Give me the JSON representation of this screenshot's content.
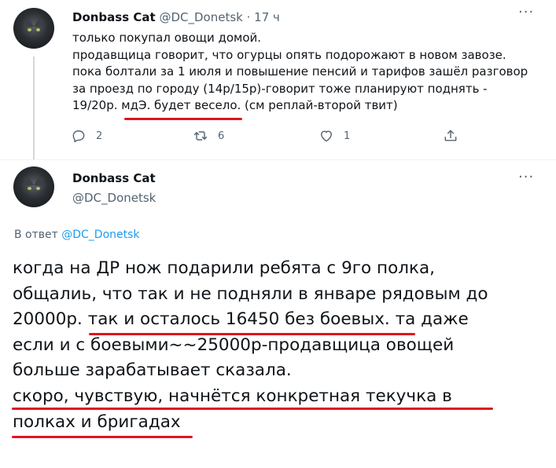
{
  "tweet": {
    "author_name": "Donbass Cat",
    "handle": "@DC_Donetsk",
    "time": "· 17 ч",
    "lines": [
      "только покупал овощи домой.",
      "продавщица говорит, что огурцы опять подорожают в новом завозе.",
      "пока болтали за 1 июля и повышение пенсий и тарифов зашёл разговор",
      "за проезд по городу (14р/15р)-говорит тоже планируют поднять -",
      "19/20р. мдЭ. будет весело. (см реплай-второй твит)"
    ],
    "reply_count": "2",
    "retweet_count": "6",
    "like_count": "1"
  },
  "reply": {
    "author_name": "Donbass Cat",
    "handle": "@DC_Donetsk",
    "reply_prefix": "В ответ",
    "reply_to": "@DC_Donetsk",
    "lines": [
      "когда на ДР нож подарили ребята с 9го полка,",
      "общалиь, что так и не подняли в январе рядовым до",
      "20000р. так и осталось 16450 без боевых. та даже",
      "если и с боевыми~~25000р-продавщица овощей",
      "больше зарабатывает сказала.",
      "скоро, чувствую, начнётся конкретная текучка в",
      "полках и бригадах"
    ]
  },
  "colors": {
    "accent": "#1d9bf0",
    "muted": "#536471",
    "highlight_underline": "#e0141f"
  },
  "icons": [
    "more-icon",
    "reply-icon",
    "retweet-icon",
    "like-icon",
    "share-icon"
  ]
}
